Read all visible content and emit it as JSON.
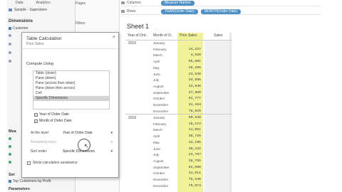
{
  "left_panel": {
    "tab_data": "Data",
    "tab_analytics": "Analytics",
    "source": "Sample - Superstore",
    "dimensions_label": "Dimensions",
    "dimension_first": "Customer",
    "measure_label": "Mea",
    "sets_label": "Set",
    "set_item": "Top Customers by Profit",
    "parameters_label": "Parameters"
  },
  "shelves": {
    "pages_label": "Pages",
    "filters_label": "Filters",
    "columns_label": "Columns",
    "rows_label": "Rows",
    "columns_pill": "Measure Names",
    "rows_pill_1": "YEAR(Order Date)",
    "rows_pill_2": "MONTH(Order Date)"
  },
  "sheet": {
    "title": "Sheet 1",
    "col_year": "Year of Ord..",
    "col_month": "Month of O..",
    "col_prior": "Prior Sales",
    "col_sales": "Sales"
  },
  "rows_2015": {
    "year": "2015",
    "months": [
      "January",
      "February",
      "March",
      "April",
      "May",
      "June",
      "July",
      "August",
      "September",
      "October",
      "November",
      "December"
    ],
    "prior": [
      "",
      "14,237",
      "4,520",
      "55,691",
      "28,295",
      "23,648",
      "34,595",
      "33,946",
      "27,909",
      "81,777",
      "31,453",
      "78,629"
    ]
  },
  "rows_2016": {
    "year": "2016",
    "months": [
      "January",
      "February",
      "March",
      "April",
      "May",
      "June",
      "July",
      "August",
      "September",
      "October",
      "November",
      "December"
    ],
    "prior": [
      "69,546",
      "18,174",
      "11,951",
      "38,726",
      "34,195",
      "30,132",
      "24,797",
      "28,765",
      "64,596",
      "31,011",
      "75,249",
      "79,973"
    ]
  },
  "dialog": {
    "title": "Table Calculation",
    "subtitle": "Prior Sales",
    "close": "×",
    "compute_using": "Compute Using",
    "options": [
      "Table (down)",
      "Pane (down)",
      "Pane (across then down)",
      "Pane (down then across)",
      "Cell",
      "Specific Dimensions"
    ],
    "check_year": "Year of Order Date",
    "check_month": "Month of Order Date",
    "at_level_label": "At the level",
    "at_level_value": "Year of Order Date",
    "restarting_label": "Restarting every",
    "sort_label": "Sort order",
    "sort_value": "Specific Dimensions",
    "show_label": "Show calculation assistance"
  }
}
